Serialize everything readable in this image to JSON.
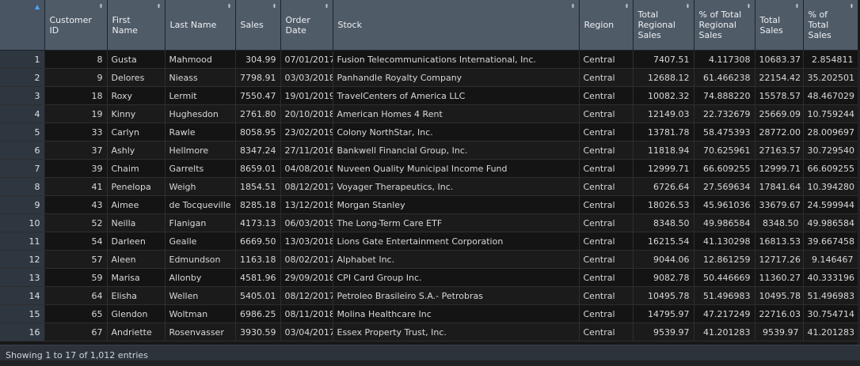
{
  "columns": [
    {
      "label": "",
      "sort": "▲"
    },
    {
      "label": "Customer ID",
      "sort": "⬍"
    },
    {
      "label": "First Name",
      "sort": "⬍"
    },
    {
      "label": "Last Name",
      "sort": "⬍"
    },
    {
      "label": "Sales",
      "sort": "⬍"
    },
    {
      "label": "Order Date",
      "sort": "⬍"
    },
    {
      "label": "Stock",
      "sort": "⬍"
    },
    {
      "label": "Region",
      "sort": "⬍"
    },
    {
      "label": "Total Regional Sales",
      "sort": "⬍"
    },
    {
      "label": "% of Total Regional Sales",
      "sort": "⬍"
    },
    {
      "label": "Total Sales",
      "sort": "⬍"
    },
    {
      "label": "% of Total Sales",
      "sort": "⬍"
    }
  ],
  "rows": [
    [
      "1",
      "8",
      "Gusta",
      "Mahmood",
      "304.99",
      "07/01/2017",
      "Fusion Telecommunications International, Inc.",
      "Central",
      "7407.51",
      "4.117308",
      "10683.37",
      "2.854811"
    ],
    [
      "2",
      "9",
      "Delores",
      "Nieass",
      "7798.91",
      "03/03/2018",
      "Panhandle Royalty Company",
      "Central",
      "12688.12",
      "61.466238",
      "22154.42",
      "35.202501"
    ],
    [
      "3",
      "18",
      "Roxy",
      "Lermit",
      "7550.47",
      "19/01/2019",
      "TravelCenters of America LLC",
      "Central",
      "10082.32",
      "74.888220",
      "15578.57",
      "48.467029"
    ],
    [
      "4",
      "19",
      "Kinny",
      "Hughesdon",
      "2761.80",
      "20/10/2018",
      "American Homes 4 Rent",
      "Central",
      "12149.03",
      "22.732679",
      "25669.09",
      "10.759244"
    ],
    [
      "5",
      "33",
      "Carlyn",
      "Rawle",
      "8058.95",
      "23/02/2019",
      "Colony NorthStar, Inc.",
      "Central",
      "13781.78",
      "58.475393",
      "28772.00",
      "28.009697"
    ],
    [
      "6",
      "37",
      "Ashly",
      "Hellmore",
      "8347.24",
      "27/11/2016",
      "Bankwell Financial Group, Inc.",
      "Central",
      "11818.94",
      "70.625961",
      "27163.57",
      "30.729540"
    ],
    [
      "7",
      "39",
      "Chaim",
      "Garrelts",
      "8659.01",
      "04/08/2016",
      "Nuveen Quality Municipal Income Fund",
      "Central",
      "12999.71",
      "66.609255",
      "12999.71",
      "66.609255"
    ],
    [
      "8",
      "41",
      "Penelopa",
      "Weigh",
      "1854.51",
      "08/12/2017",
      "Voyager Therapeutics, Inc.",
      "Central",
      "6726.64",
      "27.569634",
      "17841.64",
      "10.394280"
    ],
    [
      "9",
      "43",
      "Aimee",
      "de Tocqueville",
      "8285.18",
      "13/12/2018",
      "Morgan Stanley",
      "Central",
      "18026.53",
      "45.961036",
      "33679.67",
      "24.599944"
    ],
    [
      "10",
      "52",
      "Neilla",
      "Flanigan",
      "4173.13",
      "06/03/2019",
      "The Long-Term Care ETF",
      "Central",
      "8348.50",
      "49.986584",
      "8348.50",
      "49.986584"
    ],
    [
      "11",
      "54",
      "Darleen",
      "Gealle",
      "6669.50",
      "13/03/2018",
      "Lions Gate Entertainment Corporation",
      "Central",
      "16215.54",
      "41.130298",
      "16813.53",
      "39.667458"
    ],
    [
      "12",
      "57",
      "Aleen",
      "Edmundson",
      "1163.18",
      "08/02/2017",
      "Alphabet Inc.",
      "Central",
      "9044.06",
      "12.861259",
      "12717.26",
      "9.146467"
    ],
    [
      "13",
      "59",
      "Marisa",
      "Allonby",
      "4581.96",
      "29/09/2018",
      "CPI Card Group Inc.",
      "Central",
      "9082.78",
      "50.446669",
      "11360.27",
      "40.333196"
    ],
    [
      "14",
      "64",
      "Elisha",
      "Wellen",
      "5405.01",
      "08/12/2017",
      "Petroleo Brasileiro S.A.- Petrobras",
      "Central",
      "10495.78",
      "51.496983",
      "10495.78",
      "51.496983"
    ],
    [
      "15",
      "65",
      "Glendon",
      "Woltman",
      "6986.25",
      "08/11/2018",
      "Molina Healthcare Inc",
      "Central",
      "14795.97",
      "47.217249",
      "22716.03",
      "30.754714"
    ],
    [
      "16",
      "67",
      "Andriette",
      "Rosenvasser",
      "3930.59",
      "03/04/2017",
      "Essex Property Trust, Inc.",
      "Central",
      "9539.97",
      "41.201283",
      "9539.97",
      "41.201283"
    ]
  ],
  "status": "Showing 1 to 17 of 1,012 entries"
}
